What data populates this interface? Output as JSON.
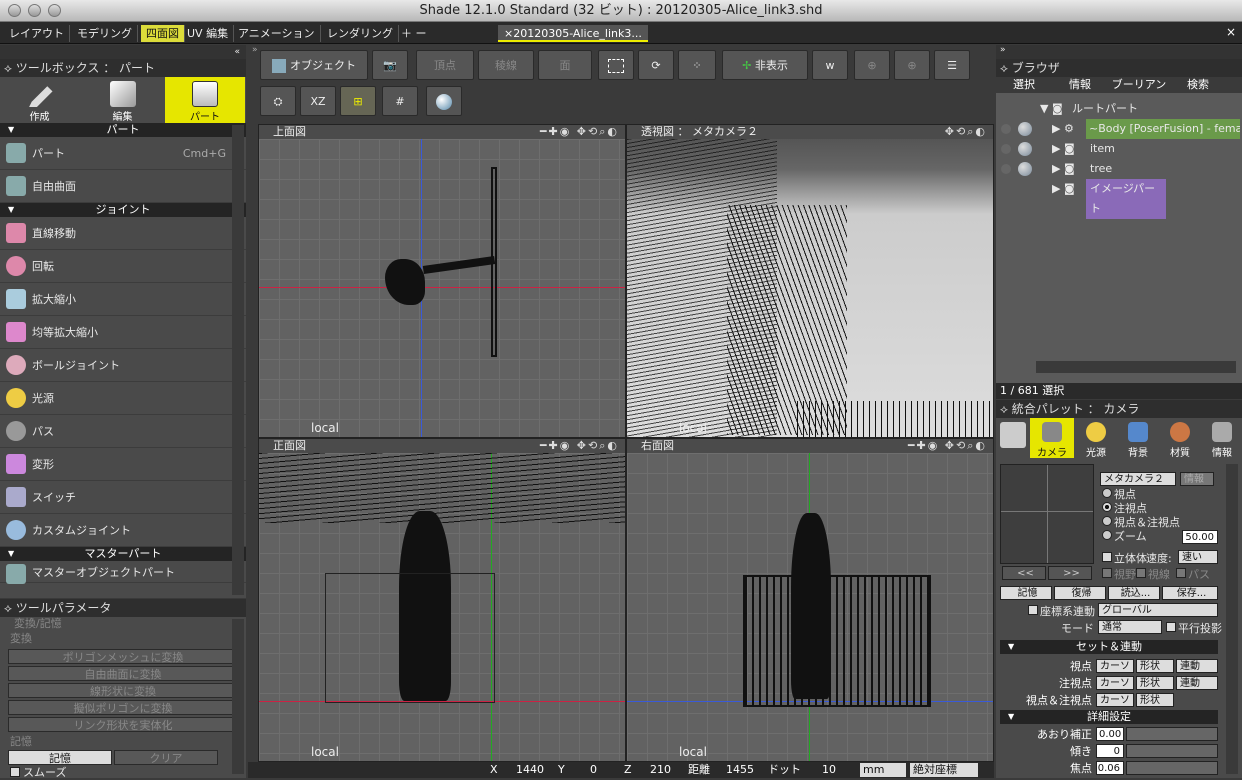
{
  "window": {
    "title": "Shade 12.1.0 Standard (32 ビット) : 20120305-Alice_link3.shd"
  },
  "menu_tabs": [
    "レイアウト",
    "モデリング",
    "四面図",
    "UV 編集",
    "アニメーション",
    "レンダリング",
    "＋ ー"
  ],
  "active_tab": "四面図",
  "doc_tab": "×20120305-Alice_link3...",
  "toolbox": {
    "title": "ツールボックス ： パート",
    "buttons": [
      {
        "label": "作成",
        "icon": "pen-icon"
      },
      {
        "label": "編集",
        "icon": "eraser-icon"
      },
      {
        "label": "パート",
        "icon": "folder-icon"
      }
    ],
    "section_part": "パート",
    "section_joint": "ジョイント",
    "section_master": "マスターパート",
    "items": [
      {
        "label": "パート",
        "shortcut": "Cmd+G",
        "icon": "part-icon"
      },
      {
        "label": "自由曲面",
        "icon": "free-surface-icon"
      },
      {
        "label": "直線移動",
        "icon": "linear-move-icon"
      },
      {
        "label": "回転",
        "icon": "rotate-icon"
      },
      {
        "label": "拡大縮小",
        "icon": "scale-icon"
      },
      {
        "label": "均等拡大縮小",
        "icon": "uniform-scale-icon"
      },
      {
        "label": "ボールジョイント",
        "icon": "ball-joint-icon"
      },
      {
        "label": "光源",
        "icon": "light-icon"
      },
      {
        "label": "パス",
        "icon": "path-icon"
      },
      {
        "label": "変形",
        "icon": "deform-icon"
      },
      {
        "label": "スイッチ",
        "icon": "switch-icon"
      },
      {
        "label": "カスタムジョイント",
        "icon": "custom-joint-icon"
      },
      {
        "label": "マスターオブジェクトパート",
        "icon": "master-object-icon"
      }
    ]
  },
  "tool_params": {
    "title": "ツールパラメータ",
    "group1": "変換/記憶",
    "group_transform": "変換",
    "buttons": [
      "ポリゴンメッシュに変換",
      "自由曲面に変換",
      "線形状に変換",
      "擬似ポリゴンに変換",
      "リンク形状を実体化"
    ],
    "group_memory": "記憶",
    "memory_btn": "記憶",
    "clear_btn": "クリア",
    "smooth": "スムーズ"
  },
  "toolbar": {
    "object": "オブジェクト",
    "vertex": "頂点",
    "edge": "稜線",
    "face": "面",
    "hide": "非表示",
    "xz": "XZ"
  },
  "viewports": [
    {
      "name": "上面図",
      "local": "local"
    },
    {
      "name": "透視図 ： メタカメラ２",
      "local": "local"
    },
    {
      "name": "正面図",
      "local": "local"
    },
    {
      "name": "右面図",
      "local": "local"
    }
  ],
  "browser": {
    "title": "ブラウザ",
    "tabs": [
      "選択",
      "情報",
      "ブーリアン",
      "検索"
    ],
    "tree": [
      {
        "label": "ルートパート",
        "indent": 0
      },
      {
        "label": "~Body [PoserFusion] - female-...",
        "indent": 1,
        "highlight": "green"
      },
      {
        "label": "item",
        "indent": 1
      },
      {
        "label": "tree",
        "indent": 1
      },
      {
        "label": "イメージパート",
        "indent": 1,
        "highlight": "purple"
      }
    ],
    "selection_count": "1 / 681 選択"
  },
  "palette": {
    "title": "統合パレット ： カメラ",
    "tabs": [
      {
        "label": "カメラ",
        "icon": "camera-icon"
      },
      {
        "label": "光源",
        "icon": "sun-icon"
      },
      {
        "label": "背景",
        "icon": "background-icon"
      },
      {
        "label": "材質",
        "icon": "material-icon"
      },
      {
        "label": "情報",
        "icon": "wrench-icon"
      }
    ],
    "camera_name": "メタカメラ２",
    "info_btn": "情報",
    "radios": [
      "視点",
      "注視点",
      "視点＆注視点",
      "ズーム"
    ],
    "zoom_value": "50.00",
    "stereo": "立体体",
    "speed_label": "速度:",
    "speed_value": "速い",
    "view_checks": [
      "視野",
      "視線",
      "パス"
    ],
    "nav_prev": "<<",
    "nav_next": ">>",
    "memory": "記憶",
    "restore": "復帰",
    "load": "読込...",
    "save": "保存...",
    "coord_sync": "座標系連動",
    "coord_value": "グローバル",
    "mode_label": "モード",
    "mode_value": "通常",
    "parallel": "平行投影",
    "set_sync": "セット＆連動",
    "sync_rows": [
      {
        "label": "視点",
        "b1": "カーソ",
        "b2": "形状",
        "b3": "連動"
      },
      {
        "label": "注視点",
        "b1": "カーソ",
        "b2": "形状",
        "b3": "連動"
      },
      {
        "label": "視点＆注視点",
        "b1": "カーソ",
        "b2": "形状",
        "b3": ""
      }
    ],
    "detail": "詳細設定",
    "detail_rows": [
      {
        "label": "あおり補正",
        "value": "0.00"
      },
      {
        "label": "傾き",
        "value": "0"
      },
      {
        "label": "焦点",
        "value": "0.06"
      }
    ]
  },
  "status": {
    "x_label": "X",
    "x": "1440",
    "y_label": "Y",
    "y": "0",
    "z_label": "Z",
    "z": "210",
    "dist_label": "距離",
    "dist": "1455",
    "dot_label": "ドット",
    "dot": "10",
    "unit": "mm",
    "coord": "絶対座標"
  }
}
